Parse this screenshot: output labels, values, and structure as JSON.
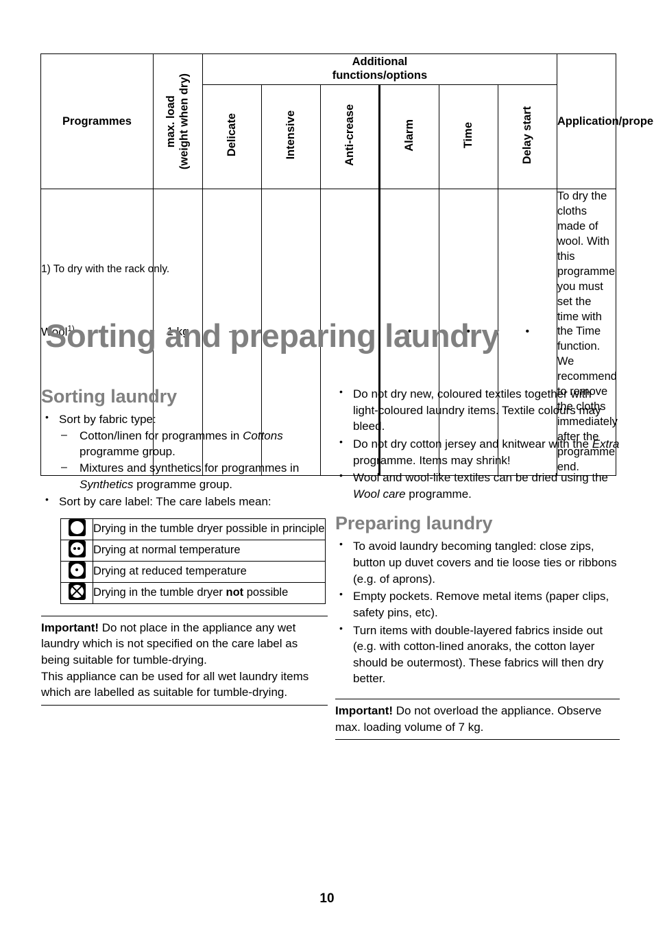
{
  "programme_table": {
    "headers": {
      "programmes": "Programmes",
      "max_load_line1": "max. load",
      "max_load_line2": "(weight when dry)",
      "additional_line1": "Additional",
      "additional_line2": "functions/options",
      "options": [
        "Delicate",
        "Intensive",
        "Anti-crease",
        "Alarm",
        "Time",
        "Delay start"
      ],
      "application": "Application/properties"
    },
    "rows": [
      {
        "programme": "Wool",
        "programme_footnote": "1)",
        "max_load": "1 kg",
        "options": [
          "–",
          "–",
          "–",
          "•",
          "•",
          "•"
        ],
        "application": "To dry the cloths made of wool. With this programme you must set the time with the Time function. We recommend to remove the cloths immediately after the programme end."
      }
    ],
    "footnote": "1) To dry with the rack only."
  },
  "main_heading": "Sorting and preparing laundry",
  "left_column": {
    "heading": "Sorting laundry",
    "bullets": [
      {
        "text": "Sort by fabric type:"
      },
      {
        "text": "Sort by care label: The care labels mean:"
      }
    ],
    "sub_bullets": [
      {
        "pre": "Cotton/linen for programmes in ",
        "italic": "Cottons",
        "post": " programme group."
      },
      {
        "pre": "Mixtures and synthetics for programmes in ",
        "italic": "Synthetics",
        "post": " programme group."
      }
    ],
    "care_table": [
      {
        "icon": "tumble-dry-possible-icon",
        "pre": "Drying in the tumble dryer possible in principle",
        "bold": "",
        "post": ""
      },
      {
        "icon": "tumble-dry-normal-temp-icon",
        "pre": "Drying at normal temperature",
        "bold": "",
        "post": ""
      },
      {
        "icon": "tumble-dry-reduced-temp-icon",
        "pre": "Drying at reduced temperature",
        "bold": "",
        "post": ""
      },
      {
        "icon": "tumble-dry-not-possible-icon",
        "pre": "Drying in the tumble dryer ",
        "bold": "not",
        "post": " possible"
      }
    ],
    "important": {
      "label": "Important!",
      "para1": " Do not place in the appliance any wet laundry which is not specified on the care label as being suitable for tumble-drying.",
      "para2": "This appliance can be used for all wet laundry items which are labelled as suitable for tumble-drying."
    }
  },
  "right_column": {
    "bullets_top": [
      {
        "pre": "Do not dry new, coloured textiles together with light-coloured laundry items. Textile colours may bleed.",
        "italic": "",
        "post": ""
      },
      {
        "pre": "Do not dry cotton jersey and knitwear with the ",
        "italic": "Extra",
        "post": " programme. Items may shrink!"
      },
      {
        "pre": "Wool and wool-like textiles can be dried using the ",
        "italic": "Wool care",
        "post": " programme."
      }
    ],
    "heading": "Preparing laundry",
    "bullets_bottom": [
      {
        "pre": "To avoid laundry becoming tangled: close zips, button up duvet covers and tie loose ties or ribbons (e.g. of aprons).",
        "italic": "",
        "post": ""
      },
      {
        "pre": "Empty pockets. Remove metal items (paper clips, safety pins, etc).",
        "italic": "",
        "post": ""
      },
      {
        "pre": "Turn items with double-layered fabrics inside out (e.g. with cotton-lined anoraks, the cotton layer should be outermost). These fabrics will then dry better.",
        "italic": "",
        "post": ""
      }
    ],
    "important": {
      "label": "Important!",
      "para1": " Do not overload the appliance. Observe max. loading volume of 7 kg."
    }
  },
  "page_number": "10",
  "colors": {
    "heading_gray": "#808080",
    "text_black": "#000000",
    "page_background": "#ffffff"
  }
}
